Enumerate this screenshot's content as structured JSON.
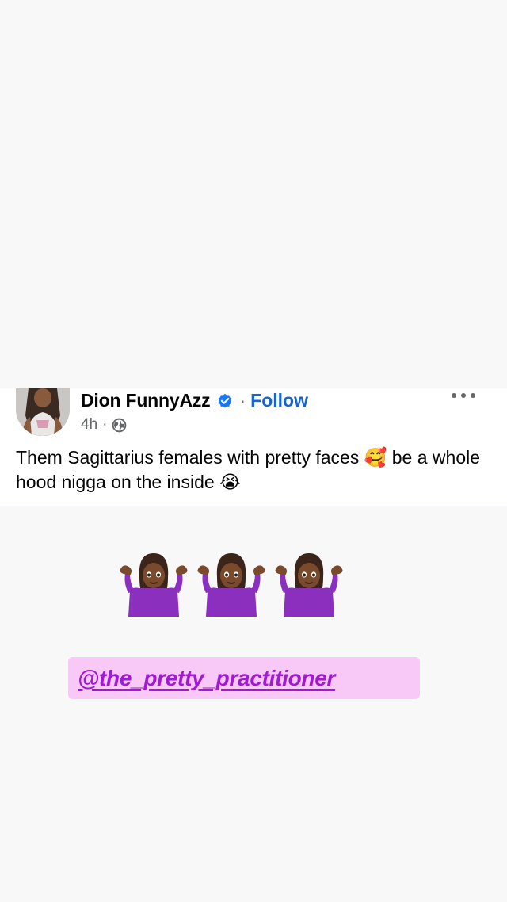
{
  "post": {
    "author_name": "Dion FunnyAzz",
    "separator": "·",
    "follow_label": "Follow",
    "time": "4h",
    "meta_separator": "·",
    "text": "Them Sagittarius females with pretty faces 🥰 be a whole hood nigga on the inside 😭",
    "icons": {
      "verified": "verified-badge-icon",
      "audience": "globe-icon",
      "more": "more-options-icon"
    }
  },
  "story": {
    "emoji_row": [
      "🤷🏾‍♀️",
      "🤷🏾‍♀️",
      "🤷🏾‍♀️"
    ],
    "mention": "@the_pretty_practitioner"
  },
  "colors": {
    "follow": "#1664cc",
    "verified": "#1877f2",
    "mention_text": "#a11ad3",
    "mention_bg": "#f8c8f6"
  }
}
